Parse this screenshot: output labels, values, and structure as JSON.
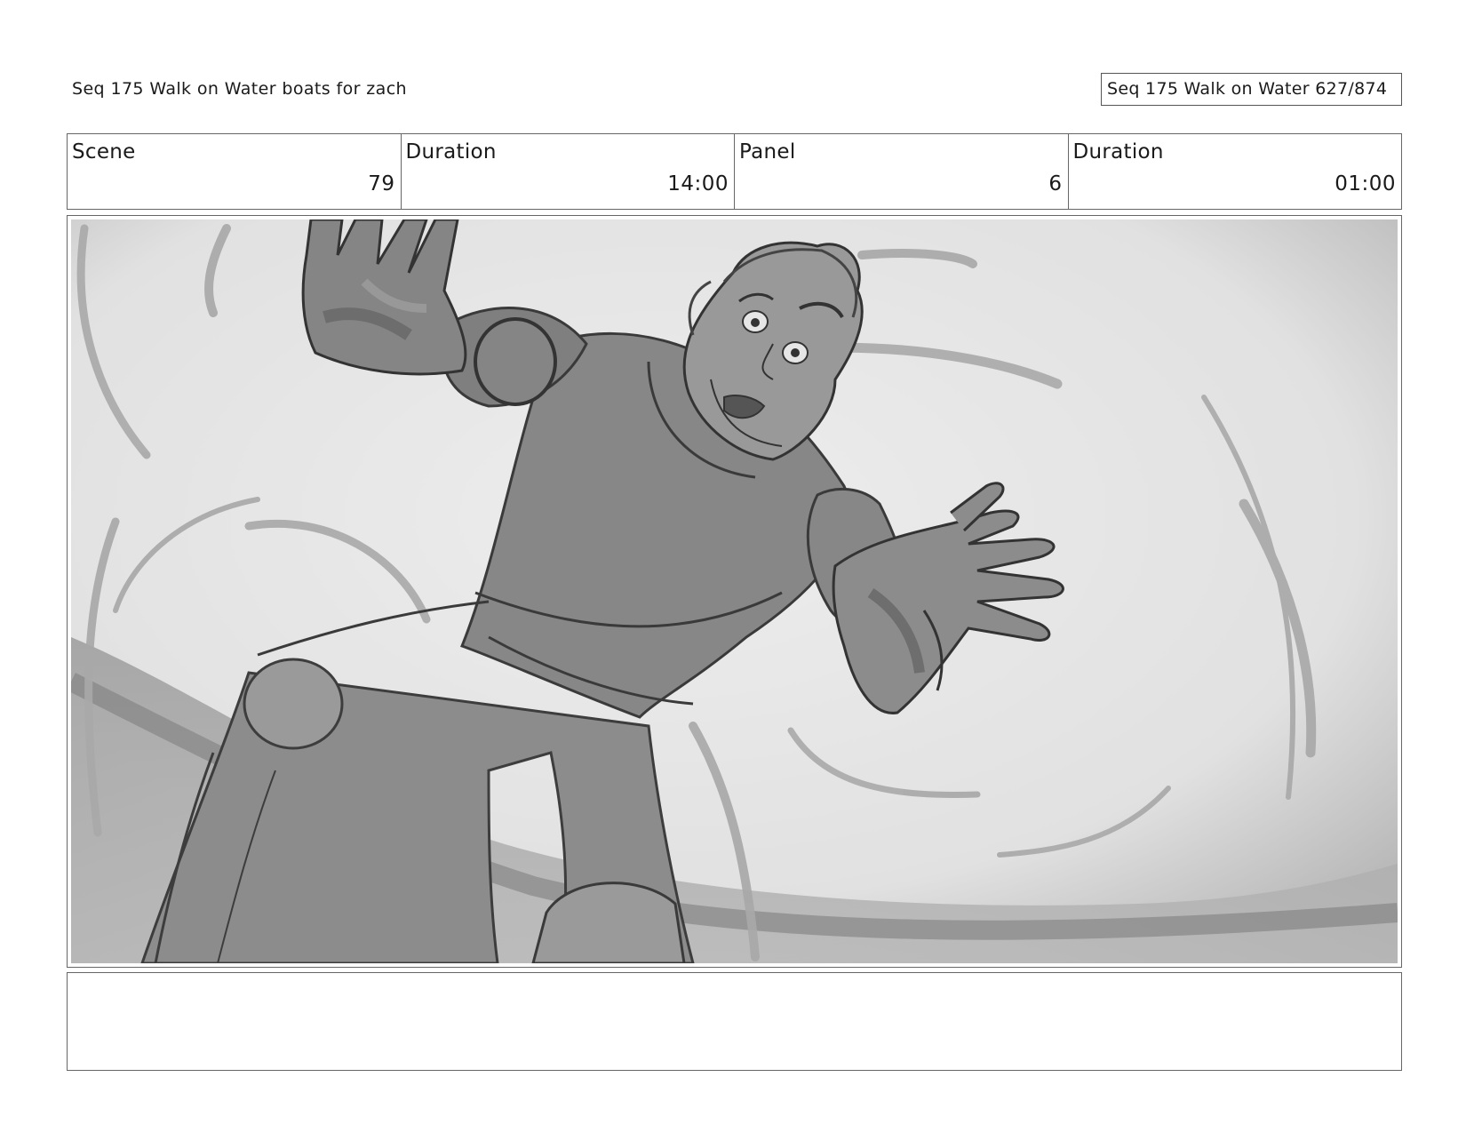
{
  "header": {
    "title": "Seq 175 Walk on Water  boats for zach",
    "page_label": "Seq 175 Walk on Water 627/874"
  },
  "info": {
    "scene_label": "Scene",
    "scene_value": "79",
    "scene_duration_label": "Duration",
    "scene_duration_value": "14:00",
    "panel_label": "Panel",
    "panel_value": "6",
    "panel_duration_label": "Duration",
    "panel_duration_value": "01:00"
  },
  "panel": {
    "subject": "grayscale storyboard sketch",
    "colors": {
      "background_light": "#ececec",
      "background_dark": "#9a9a9a",
      "figure_fill": "#8a8a8a",
      "skin_fill": "#9c9c9c",
      "line": "#3a3a3a",
      "swoosh": "#b0b0b0"
    }
  },
  "notes": {
    "text": ""
  }
}
